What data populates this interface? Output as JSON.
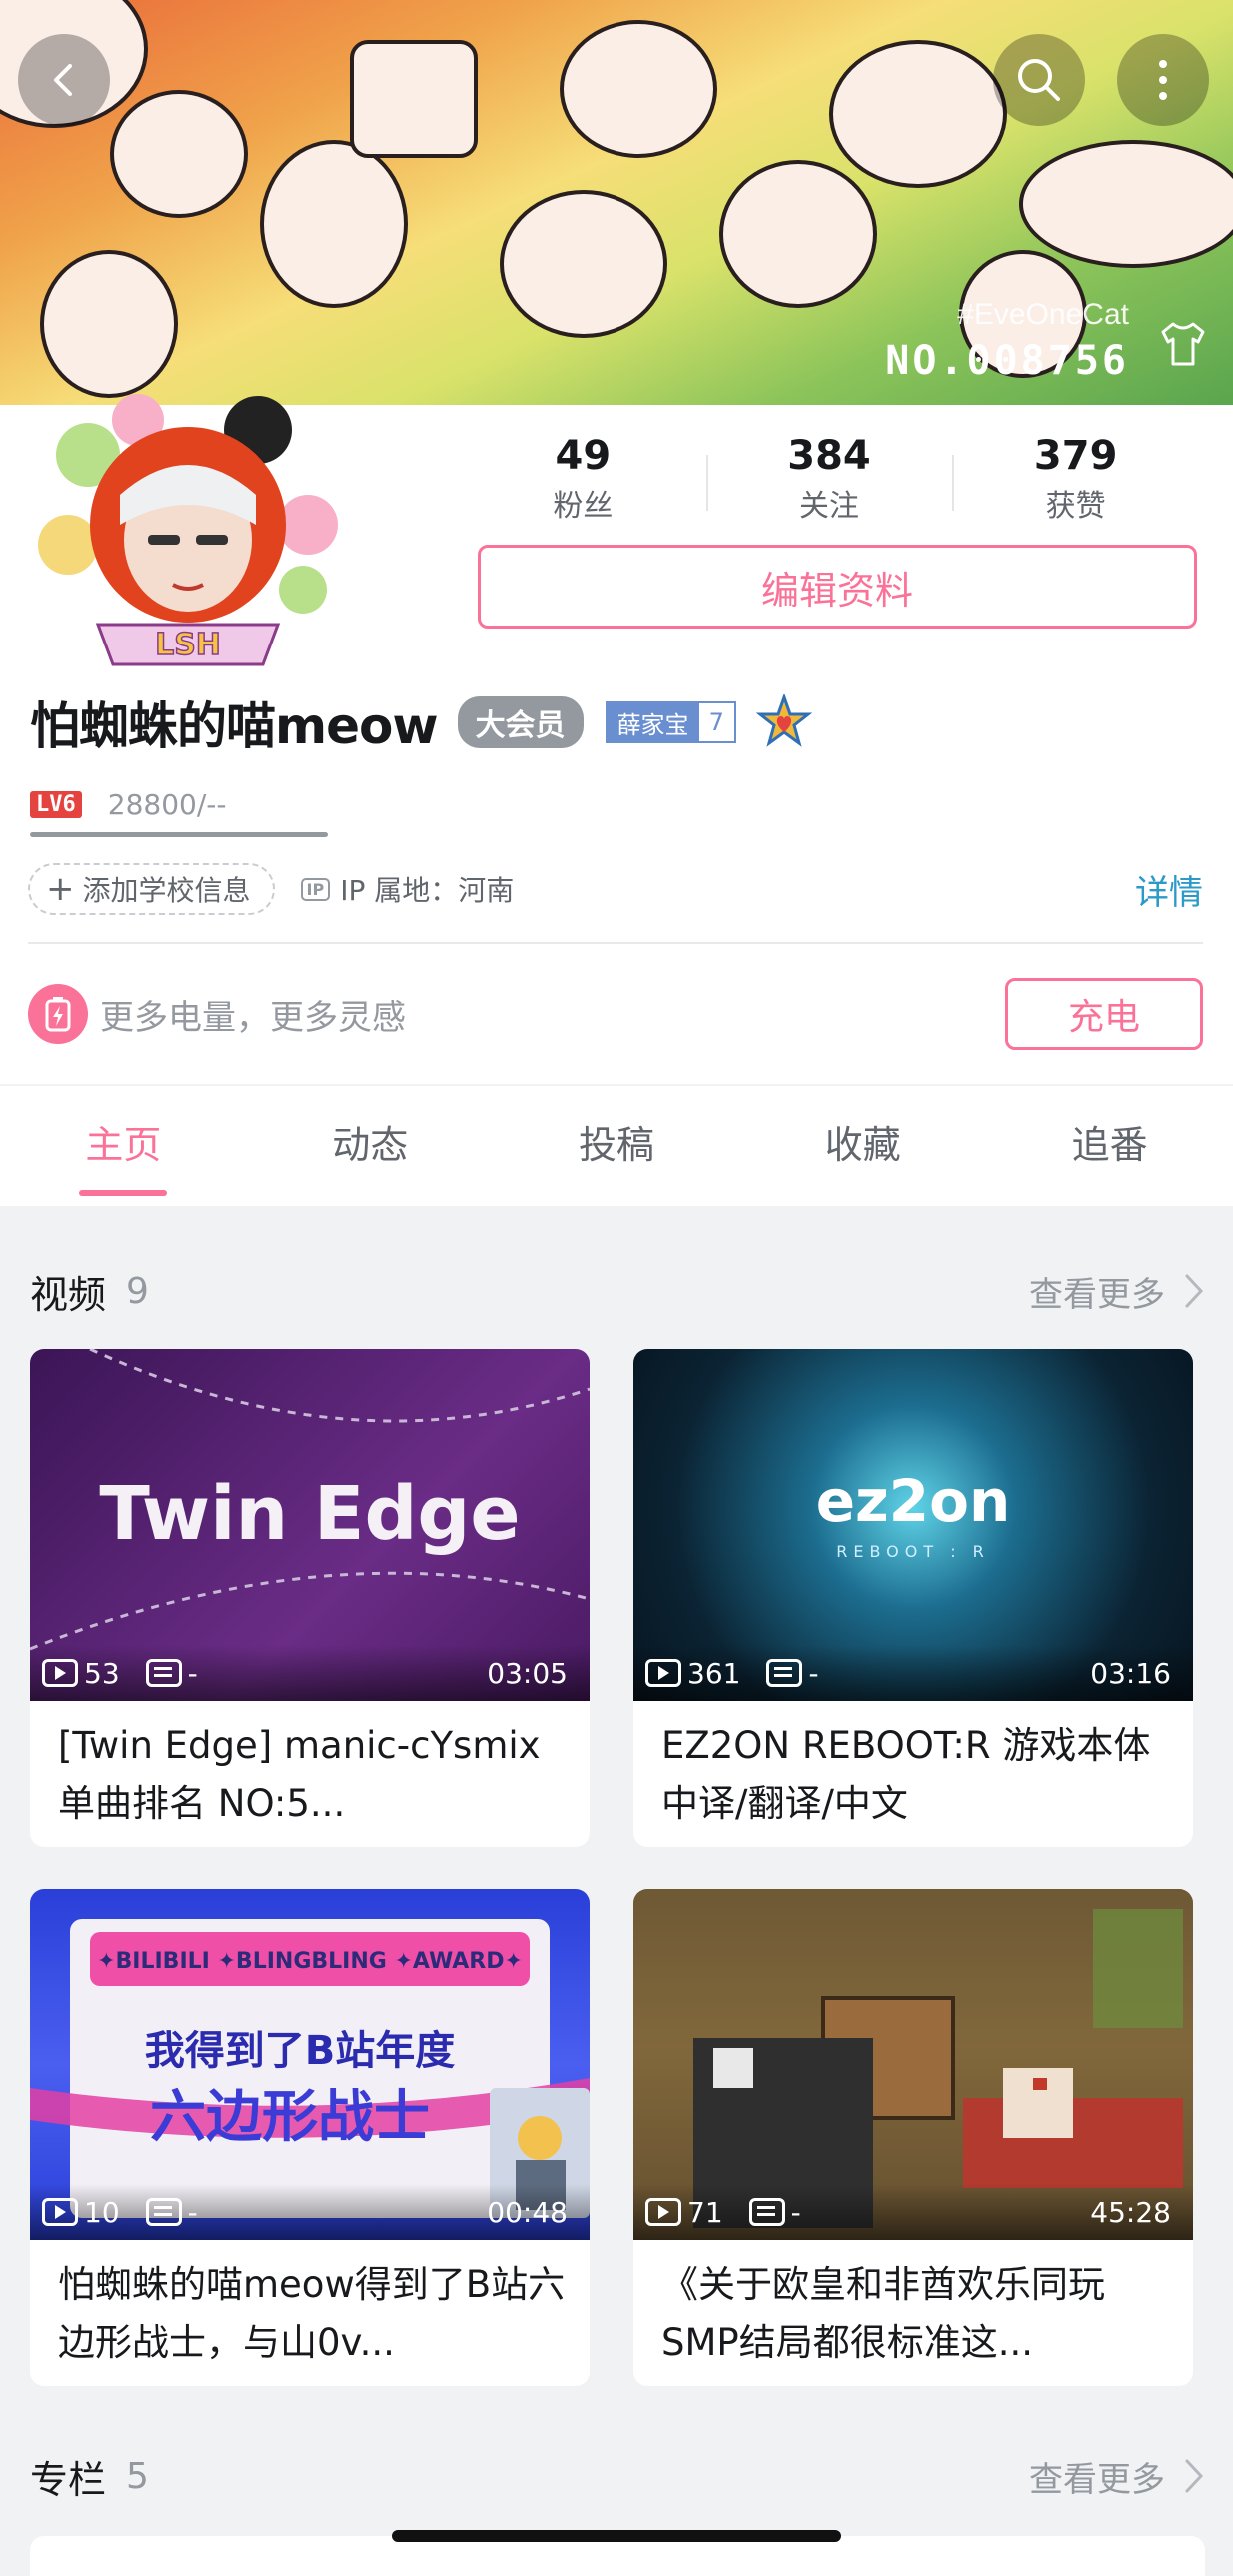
{
  "banner": {
    "tag": "#EveOneCat",
    "number": "NO.008756",
    "back_icon": "chevron-left-icon",
    "search_icon": "search-icon",
    "more_icon": "more-vertical-icon",
    "dress_icon": "t-shirt-icon"
  },
  "profile": {
    "avatar_text": "LSH",
    "stats": [
      {
        "num": "49",
        "label": "粉丝"
      },
      {
        "num": "384",
        "label": "关注"
      },
      {
        "num": "379",
        "label": "获赞"
      }
    ],
    "edit_label": "编辑资料",
    "username": "怕蜘蛛的喵meow",
    "vip_label": "大会员",
    "medal_name": "薛家宝",
    "medal_level": "7",
    "level": "LV6",
    "exp": "28800/--",
    "add_school": "添加学校信息",
    "ip_label": "IP",
    "ip_text": "IP 属地：河南",
    "detail": "详情",
    "charge_text": "更多电量，更多灵感",
    "charge_btn": "充电"
  },
  "tabs": [
    {
      "label": "主页",
      "active": true
    },
    {
      "label": "动态"
    },
    {
      "label": "投稿"
    },
    {
      "label": "收藏"
    },
    {
      "label": "追番"
    }
  ],
  "videos_section": {
    "title": "视频",
    "count": "9",
    "more": "查看更多"
  },
  "videos": [
    {
      "title": "[Twin Edge] manic-cYsmix 单曲排名 NO:5...",
      "views": "53",
      "danmaku": "-",
      "duration": "03:05",
      "thumb_text": "Twin Edge"
    },
    {
      "title": "EZ2ON REBOOT:R 游戏本体 中译/翻译/中文",
      "views": "361",
      "danmaku": "-",
      "duration": "03:16",
      "thumb_text": "ez2on",
      "thumb_sub": "REBOOT : R"
    },
    {
      "title": "怕蜘蛛的喵meow得到了B站六边形战士，与山0v...",
      "views": "10",
      "danmaku": "-",
      "duration": "00:48",
      "thumb_text": "✦BILIBILI ✦BLINGBLING ✦AWARD✦",
      "thumb_line1": "我得到了B站年度",
      "thumb_line2": "六边形战士"
    },
    {
      "title": "《关于欧皇和非酋欢乐同玩SMP结局都很标准这...",
      "views": "71",
      "danmaku": "-",
      "duration": "45:28"
    }
  ],
  "columns_section": {
    "title": "专栏",
    "count": "5",
    "more": "查看更多"
  },
  "colors": {
    "accent": "#fb7299",
    "link": "#2b9ac9",
    "muted": "#9499a0"
  }
}
